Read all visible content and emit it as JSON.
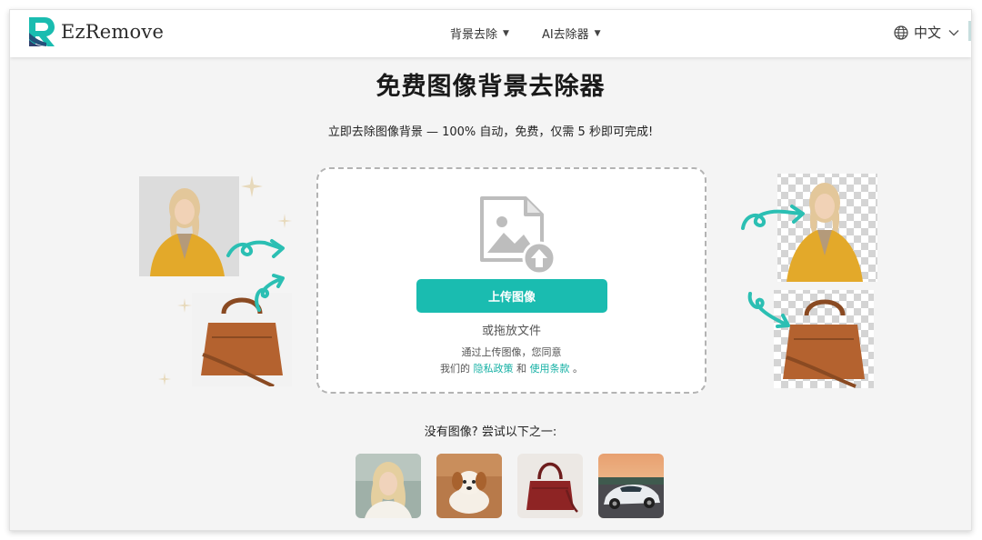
{
  "navbar": {
    "brand": "EzRemove",
    "menu": [
      {
        "label": "背景去除"
      },
      {
        "label": "AI去除器"
      }
    ],
    "language": "中文"
  },
  "hero": {
    "title": "免费图像背景去除器",
    "subtitle": "立即去除图像背景 — 100% 自动，免费，仅需 5 秒即可完成!"
  },
  "upload": {
    "button_label": "上传图像",
    "or_drop": "或拖放文件",
    "terms_line1": "通过上传图像，您同意",
    "terms_prefix": "我们的",
    "privacy_link": "隐私政策",
    "and": "和",
    "terms_link": "使用条款",
    "period": "。"
  },
  "samples": {
    "prompt": "没有图像? 尝试以下之一:",
    "items": [
      {
        "icon": "woman-photo"
      },
      {
        "icon": "puppy-photo"
      },
      {
        "icon": "red-handbag-photo"
      },
      {
        "icon": "sports-car-photo"
      }
    ]
  },
  "colors": {
    "accent": "#1abcb0",
    "link": "#17b1a5",
    "arrow": "#2bbfb3",
    "jacket": "#e3a92a",
    "bag": "#b4622f"
  }
}
